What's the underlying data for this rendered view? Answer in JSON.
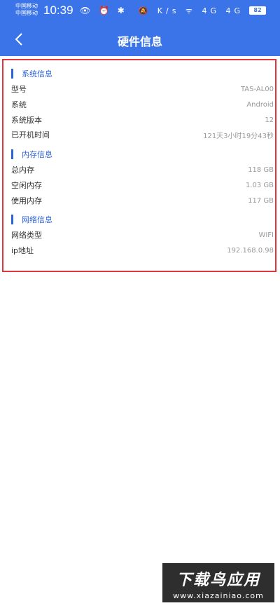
{
  "statusbar": {
    "carrier1": "中国移动",
    "carrier2": "中国移动",
    "time": "10:39",
    "left_icons": "👁 ⏰ ✱",
    "right_icons": "🔕 K/s ᯤ 4G 4G",
    "battery": "82"
  },
  "header": {
    "title": "硬件信息"
  },
  "system": {
    "title": "系统信息",
    "rows": [
      {
        "k": "型号",
        "v": "TAS-AL00"
      },
      {
        "k": "系统",
        "v": "Android"
      },
      {
        "k": "系统版本",
        "v": "12"
      },
      {
        "k": "已开机时间",
        "v": "121天3小时19分43秒"
      }
    ]
  },
  "memory": {
    "title": "内存信息",
    "rows": [
      {
        "k": "总内存",
        "v": "118 GB"
      },
      {
        "k": "空闲内存",
        "v": "1.03 GB"
      },
      {
        "k": "使用内存",
        "v": "117 GB"
      }
    ]
  },
  "network": {
    "title": "网络信息",
    "rows": [
      {
        "k": "网络类型",
        "v": "WIFI"
      },
      {
        "k": "ip地址",
        "v": "192.168.0.98"
      }
    ]
  },
  "watermark": {
    "top": "下载鸟应用",
    "bottom": "www.xiazainiao.com"
  },
  "colors": {
    "header": "#3a74e8",
    "accent": "#2e63d6",
    "highlight_border": "#e0353a"
  }
}
